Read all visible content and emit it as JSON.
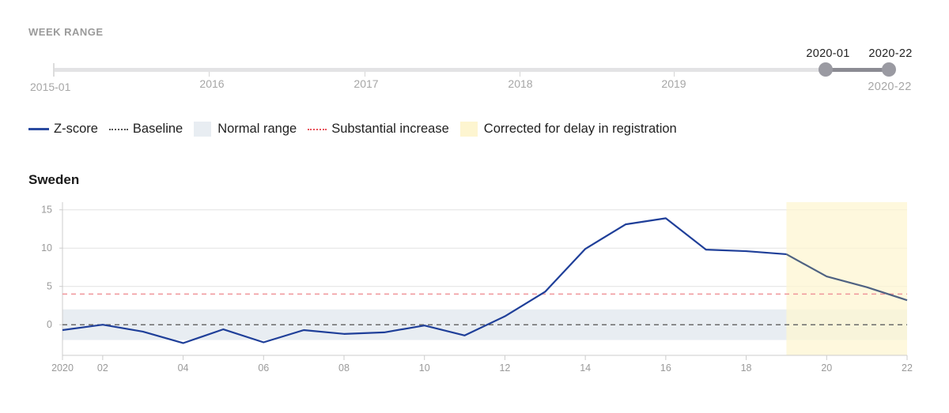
{
  "week_range": {
    "title": "WEEK RANGE",
    "start_label": "2015-01",
    "year_labels": [
      "2016",
      "2017",
      "2018",
      "2019"
    ],
    "selected_start": "2020-01",
    "selected_end": "2020-22",
    "end_label": "2020-22"
  },
  "legend": {
    "items": [
      {
        "label": "Z-score",
        "kind": "line",
        "color": "#2a4aa0"
      },
      {
        "label": "Baseline",
        "kind": "dotted",
        "color": "#555555"
      },
      {
        "label": "Normal range",
        "kind": "box",
        "color": "#e8edf2"
      },
      {
        "label": "Substantial increase",
        "kind": "dotted",
        "color": "#e8525a"
      },
      {
        "label": "Corrected for delay in registration",
        "kind": "box",
        "color": "#fdf5d0"
      }
    ]
  },
  "colors": {
    "zscore": "#1f3f99",
    "zscore_corrected": "#4f6282",
    "baseline": "#6b6b6b",
    "normal_range": "#e8edf2",
    "substantial": "#f0959a",
    "correction_band": "#fdf6d2",
    "grid": "#e2e2e2",
    "axis": "#cccccc"
  },
  "chart_data": {
    "type": "line",
    "title": "Sweden",
    "xlabel": "",
    "ylabel": "",
    "x": [
      1,
      2,
      3,
      4,
      5,
      6,
      7,
      8,
      9,
      10,
      11,
      12,
      13,
      14,
      15,
      16,
      17,
      18,
      19,
      20,
      21,
      22
    ],
    "x_tick_values": [
      1,
      2,
      4,
      6,
      8,
      10,
      12,
      14,
      16,
      18,
      20,
      22
    ],
    "x_tick_labels": [
      "2020",
      "02",
      "04",
      "06",
      "08",
      "10",
      "12",
      "14",
      "16",
      "18",
      "20",
      "22"
    ],
    "xlim": [
      1,
      22
    ],
    "y_ticks": [
      0,
      5,
      10,
      15
    ],
    "y_tick_labels": [
      "0",
      "5",
      "10",
      "15"
    ],
    "ylim": [
      -4,
      16
    ],
    "grid": true,
    "series": [
      {
        "name": "Z-score",
        "values": [
          -0.7,
          0.0,
          -0.9,
          -2.4,
          -0.6,
          -2.3,
          -0.7,
          -1.2,
          -1.0,
          -0.1,
          -1.4,
          1.1,
          4.3,
          9.9,
          13.1,
          13.9,
          9.8,
          9.6,
          9.2,
          6.3,
          4.9,
          3.2
        ]
      }
    ],
    "baseline": 0,
    "normal_range": [
      -2,
      2
    ],
    "substantial_increase": 4,
    "corrected_from_week": 19,
    "corrected_to_week": 22,
    "legend_position": "top-left"
  }
}
